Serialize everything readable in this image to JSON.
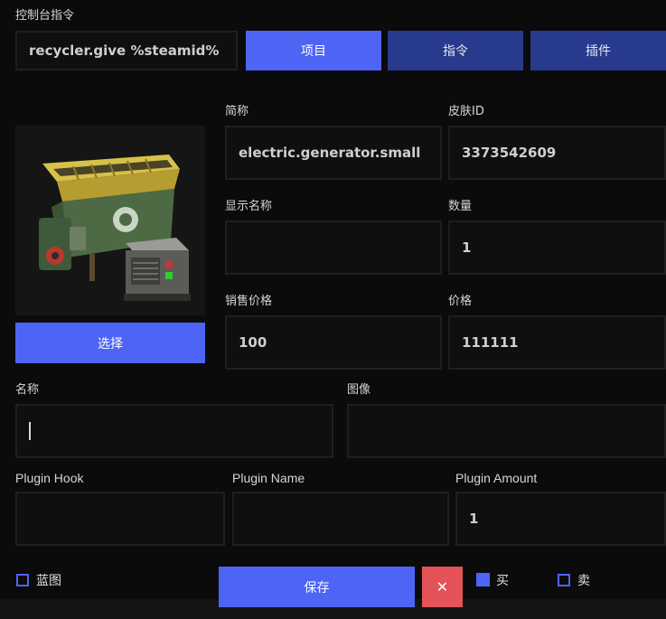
{
  "console": {
    "label": "控制台指令",
    "command_value": "recycler.give %steamid%"
  },
  "tabs": [
    {
      "label": "项目",
      "active": true
    },
    {
      "label": "指令",
      "active": false
    },
    {
      "label": "插件",
      "active": false
    }
  ],
  "item": {
    "image_alt_icon": "recycler-image",
    "select_label": "选择",
    "shortname_label": "简称",
    "shortname_value": "electric.generator.small",
    "skin_label": "皮肤ID",
    "skin_value": "3373542609",
    "display_name_label": "显示名称",
    "display_name_value": "",
    "amount_label": "数量",
    "amount_value": "1",
    "sell_price_label": "销售价格",
    "sell_price_value": "100",
    "price_label": "价格",
    "price_value": "111111",
    "name_label": "名称",
    "name_value": "",
    "image_label": "图像",
    "image_value": ""
  },
  "plugin": {
    "hook_label": "Plugin Hook",
    "hook_value": "",
    "name_label": "Plugin Name",
    "name_value": "",
    "amount_label": "Plugin Amount",
    "amount_value": "1"
  },
  "footer": {
    "blueprint_label": "蓝图",
    "blueprint_checked": false,
    "save_label": "保存",
    "close_glyph": "✕",
    "buy_label": "买",
    "buy_checked": true,
    "sell_label": "卖",
    "sell_checked": false
  },
  "colors": {
    "accent": "#4e64f5",
    "tab_inactive": "#273a8c",
    "danger": "#e35357",
    "background": "#0b0b0b"
  }
}
